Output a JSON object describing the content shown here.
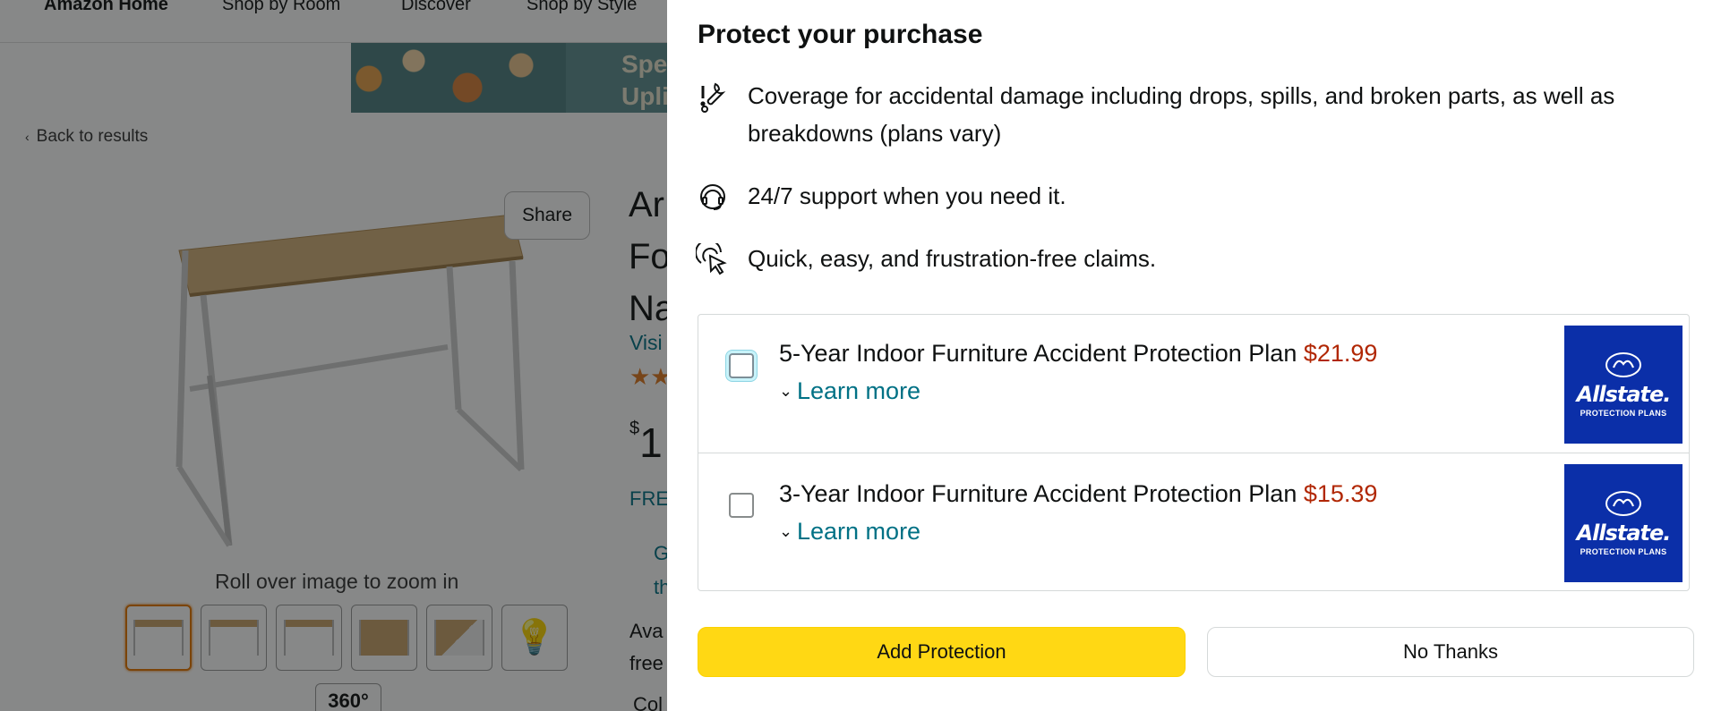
{
  "background_page": {
    "nav_items": [
      "Amazon Home",
      "Shop by Room",
      "Discover",
      "Shop by Style"
    ],
    "banner_text": [
      "Spe",
      "Upli"
    ],
    "back_link": "Back to results",
    "share_label": "Share",
    "zoom_hint": "Roll over image to zoom in",
    "view_360": "360°",
    "title_lines": [
      "Ar",
      "Fo",
      "Na"
    ],
    "visit_store": "Visi",
    "price_symbol": "$",
    "price_partial": "1",
    "shipping_partial": "FRE",
    "gift_lines": [
      "G",
      "th"
    ],
    "availability_lines": [
      "Ava",
      "free"
    ],
    "color_label": "Col"
  },
  "sheet": {
    "title": "Protect your purchase",
    "benefits": [
      {
        "icon": "wrench-alert-icon",
        "text": "Coverage for accidental damage including drops, spills, and broken parts, as well as breakdowns (plans vary)"
      },
      {
        "icon": "headset-support-icon",
        "text": "24/7 support when you need it."
      },
      {
        "icon": "pointer-click-icon",
        "text": "Quick, easy, and frustration-free claims."
      }
    ],
    "plans": [
      {
        "name": "5-Year Indoor Furniture Accident Protection Plan",
        "price": "$21.99",
        "learn_more": "Learn more",
        "checked": false,
        "logo_brand": "Allstate.",
        "logo_sub": "PROTECTION PLANS"
      },
      {
        "name": "3-Year Indoor Furniture Accident Protection Plan",
        "price": "$15.39",
        "learn_more": "Learn more",
        "checked": false,
        "logo_brand": "Allstate.",
        "logo_sub": "PROTECTION PLANS"
      }
    ],
    "add_button": "Add Protection",
    "decline_button": "No Thanks"
  },
  "colors": {
    "accent_button": "#ffd814",
    "link": "#007185",
    "price": "#b12704",
    "brand_logo_bg": "#0b2fa8"
  }
}
